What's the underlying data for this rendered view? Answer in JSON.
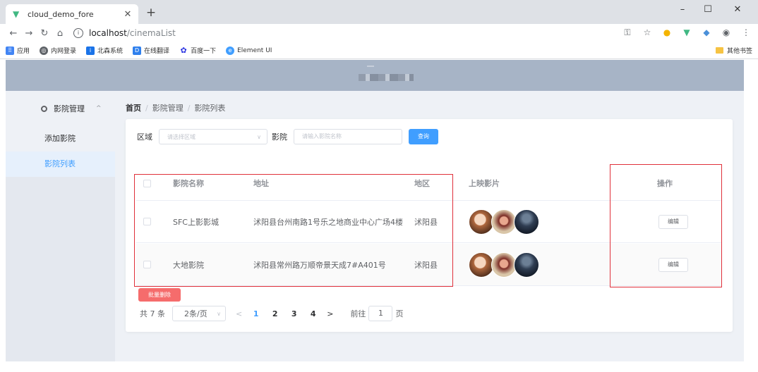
{
  "browser": {
    "tab_title": "cloud_demo_fore",
    "url_host": "localhost",
    "url_path": "/cinemaList",
    "bookmarks": [
      {
        "label": "应用",
        "icon": "apps-grid-icon",
        "color": "#4285f4"
      },
      {
        "label": "内网登录",
        "icon": "globe-icon",
        "color": "#5f6368"
      },
      {
        "label": "北森系统",
        "icon": "beisen-icon",
        "color": "#1a73e8"
      },
      {
        "label": "在线翻译",
        "icon": "translate-icon",
        "color": "#2f80ed"
      },
      {
        "label": "百度一下",
        "icon": "baidu-paw-icon",
        "color": "#2932e1"
      },
      {
        "label": "Element UI",
        "icon": "element-icon",
        "color": "#409eff"
      }
    ],
    "other_bookmarks": "其他书签"
  },
  "sidebar": {
    "group_label": "影院管理",
    "items": [
      {
        "label": "添加影院",
        "active": false
      },
      {
        "label": "影院列表",
        "active": true
      }
    ]
  },
  "breadcrumb": {
    "home": "首页",
    "level1": "影院管理",
    "level2": "影院列表",
    "separator": "/"
  },
  "filter": {
    "region_label": "区域",
    "region_placeholder": "请选择区域",
    "cinema_label": "影院",
    "cinema_placeholder": "请输入影院名称",
    "search_button": "查询"
  },
  "table": {
    "headers": {
      "name": "影院名称",
      "address": "地址",
      "region": "地区",
      "movies": "上映影片",
      "actions": "操作"
    },
    "rows": [
      {
        "name": "SFC上影影城",
        "address": "沭阳县台州南路1号乐之地商业中心广场4楼",
        "region": "沭阳县",
        "edit": "编辑"
      },
      {
        "name": "大地影院",
        "address": "沭阳县常州路万顺帝景天成7#A401号",
        "region": "沭阳县",
        "edit": "编辑"
      }
    ]
  },
  "batch_delete": "批量删除",
  "pagination": {
    "total": "共 7 条",
    "page_size": "2条/页",
    "pages": [
      "1",
      "2",
      "3",
      "4"
    ],
    "current": "1",
    "goto_prefix": "前往",
    "goto_value": "1",
    "goto_suffix": "页"
  },
  "colors": {
    "primary": "#409eff",
    "danger": "#f56c6c",
    "highlight_box": "#e0303a",
    "header_bg": "#a7b4c6"
  }
}
